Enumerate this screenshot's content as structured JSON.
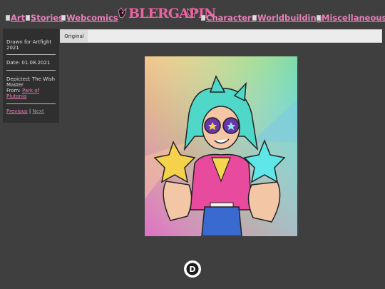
{
  "nav": {
    "art": "Art",
    "stories": "Stories",
    "webcomics": "Webcomics",
    "characters": "Characters",
    "worldbuilding": "Worldbuilding",
    "miscellaneous": "Miscellaneous"
  },
  "logo": {
    "text": "BLERGAPIN"
  },
  "sidebar": {
    "title": "Drawn for Artfight 2021",
    "date": "Date: 01.08.2021",
    "depicted": "Depicted: The Wish Master",
    "from_label": "From:",
    "from_link": "Park of Plutonia",
    "previous": "Previous",
    "separator": "|",
    "next": "Next"
  },
  "tabs": {
    "original": "Original"
  },
  "colors": {
    "accent": "#e87fb8",
    "background": "#3f3f3f",
    "sidebar_bg": "#2f2f2f"
  },
  "icons": {
    "disqus": "disqus-logo-icon"
  }
}
